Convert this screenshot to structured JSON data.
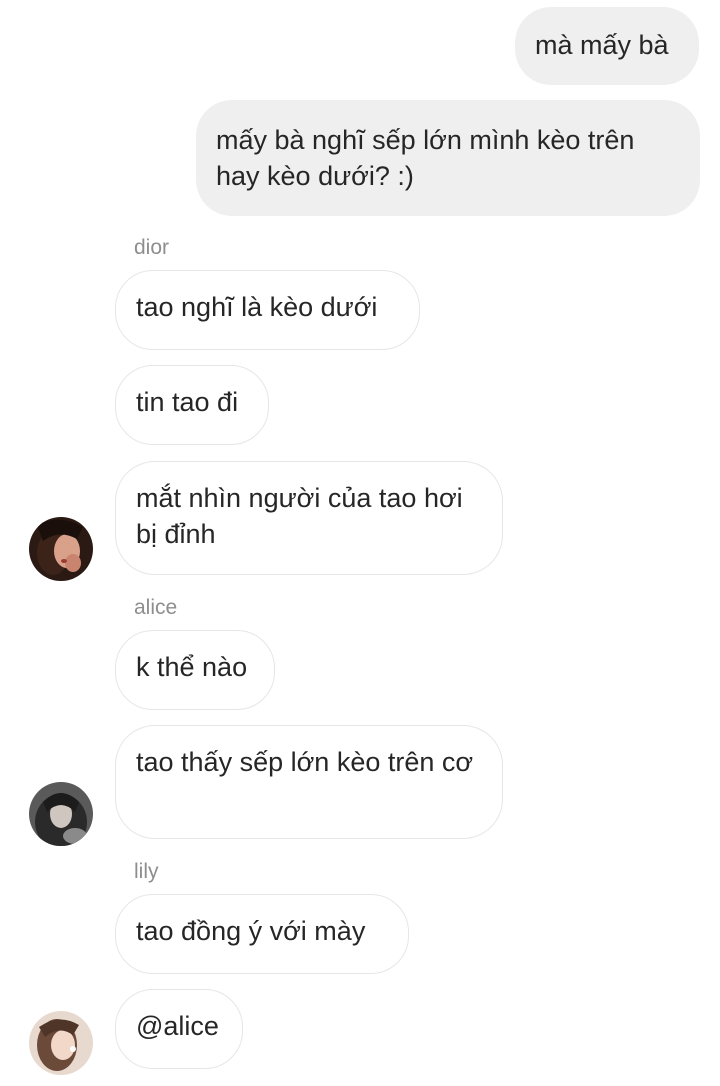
{
  "messages": {
    "outgoing_1": "mà mấy bà",
    "outgoing_2": "mấy bà nghĩ sếp lớn mình kèo trên hay kèo dưới? :)",
    "dior": {
      "sender": "dior",
      "msg1": "tao nghĩ là kèo dưới",
      "msg2": "tin tao đi",
      "msg3": "mắt nhìn người của tao hơi bị đỉnh"
    },
    "alice": {
      "sender": "alice",
      "msg1": "k thể nào",
      "msg2": "tao thấy sếp lớn kèo trên cơ"
    },
    "lily": {
      "sender": "lily",
      "msg1": "tao đồng ý với mày",
      "msg2": "@alice"
    }
  },
  "colors": {
    "outgoing_bubble": "#efefef",
    "incoming_border": "#e6e6e6",
    "text": "#262626",
    "sender_label": "#8e8e8e"
  }
}
